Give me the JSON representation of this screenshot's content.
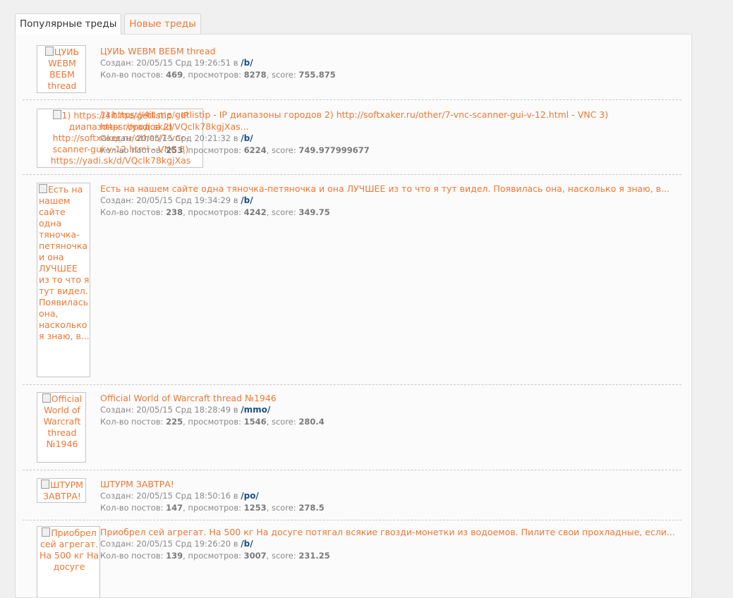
{
  "tabs": [
    {
      "label": "Популярные треды",
      "active": true
    },
    {
      "label": "Новые треды",
      "active": false
    }
  ],
  "labels": {
    "created": "Создан:",
    "in": "в",
    "posts": "Кол-во постов:",
    "views": "просмотров:",
    "score": "score:"
  },
  "threads": [
    {
      "title": "ЦУИЬ WEBM ВЕБМ thread",
      "thumb_alt": "ЦУИЬ WEBM ВЕБМ thread",
      "created": "20/05/15 Срд 19:26:51",
      "board": "/b/",
      "posts": "469",
      "views": "8278",
      "score": "755.875"
    },
    {
      "title": "1) https://4it.me/getlistip - IP диапазоны городов 2) http://softxaker.ru/other/7-vnc-scanner-gui-v-12.html - VNC 3) https://yadi.sk/d/VQclk78kgjXas...",
      "thumb_alt": "1) https://4it.me/getlistip - IP диапазоны городов 2) http://softxaker.ru/other/7-vnc-scanner-gui-v-12.html - VNC 3) https://yadi.sk/d/VQclk78kgjXas",
      "created": "20/05/15 Срд 20:21:32",
      "board": "/b/",
      "posts": "253",
      "views": "6224",
      "score": "749.977999677"
    },
    {
      "title": "Есть на нашем сайте одна тяночка-петяночка и она ЛУЧШЕЕ из то что я тут видел. Появилась она, насколько я знаю, в...",
      "thumb_alt": "Есть на нашем сайте одна тяночка-петяночка и она ЛУЧШЕЕ из то что я тут видел. Появилась она, насколько я знаю, в...",
      "created": "20/05/15 Срд 19:34:29",
      "board": "/b/",
      "posts": "238",
      "views": "4242",
      "score": "349.75"
    },
    {
      "title": "Official World of Warcraft thread №1946",
      "thumb_alt": "Official World of Warcraft thread №1946",
      "created": "20/05/15 Срд 18:28:49",
      "board": "/mmo/",
      "posts": "225",
      "views": "1546",
      "score": "280.4"
    },
    {
      "title": "ШТУРМ ЗАВТРА!",
      "thumb_alt": "ШТУРМ ЗАВТРА!",
      "created": "20/05/15 Срд 18:50:16",
      "board": "/po/",
      "posts": "147",
      "views": "1253",
      "score": "278.5"
    },
    {
      "title": "Приобрел сей агрегат. На 500 кг На досуге потягал всякие гвозди-монетки из водоемов. Пилите свои прохладные, если...",
      "thumb_alt": "Приобрел сей агрегат. На 500 кг На досуге",
      "created": "20/05/15 Срд 19:26:20",
      "board": "/b/",
      "posts": "139",
      "views": "3007",
      "score": "231.25"
    }
  ]
}
